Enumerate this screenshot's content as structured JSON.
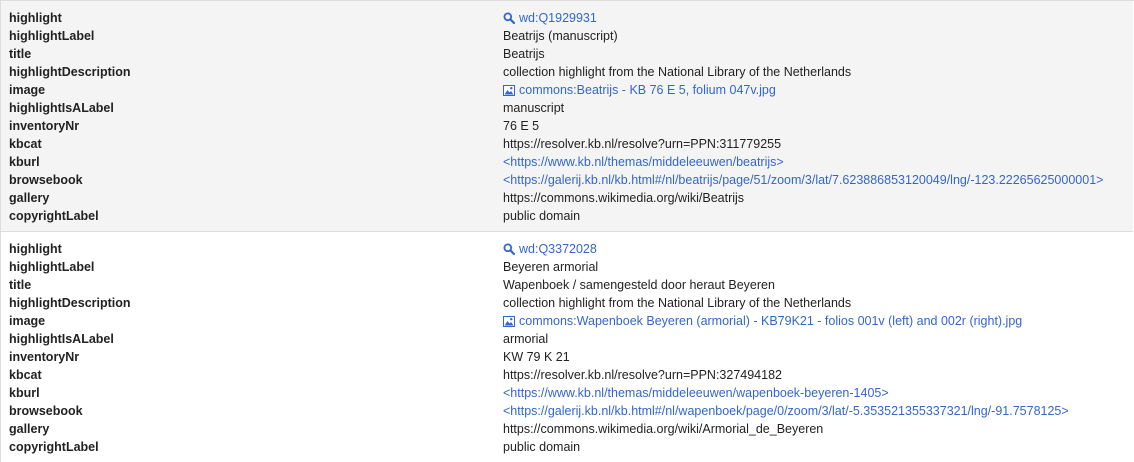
{
  "icons": {
    "entity_link": "search-icon",
    "image_link": "image-icon",
    "link_color": "#3366cc"
  },
  "records": [
    {
      "keys": {
        "highlight": "highlight",
        "highlightLabel": "highlightLabel",
        "title": "title",
        "highlightDescription": "highlightDescription",
        "image": "image",
        "highlightIsALabel": "highlightIsALabel",
        "inventoryNr": "inventoryNr",
        "kbcat": "kbcat",
        "kburl": "kburl",
        "browsebook": "browsebook",
        "gallery": "gallery",
        "copyrightLabel": "copyrightLabel"
      },
      "values": {
        "highlight": "wd:Q1929931",
        "highlightLabel": "Beatrijs (manuscript)",
        "title": "Beatrijs",
        "highlightDescription": "collection highlight from the National Library of the Netherlands",
        "image": "commons:Beatrijs - KB 76 E 5, folium 047v.jpg",
        "highlightIsALabel": "manuscript",
        "inventoryNr": "76 E 5",
        "kbcat": "https://resolver.kb.nl/resolve?urn=PPN:311779255",
        "kburl": "<https://www.kb.nl/themas/middeleeuwen/beatrijs>",
        "browsebook": "<https://galerij.kb.nl/kb.html#/nl/beatrijs/page/51/zoom/3/lat/7.623886853120049/lng/-123.22265625000001>",
        "gallery": "https://commons.wikimedia.org/wiki/Beatrijs",
        "copyrightLabel": "public domain"
      }
    },
    {
      "keys": {
        "highlight": "highlight",
        "highlightLabel": "highlightLabel",
        "title": "title",
        "highlightDescription": "highlightDescription",
        "image": "image",
        "highlightIsALabel": "highlightIsALabel",
        "inventoryNr": "inventoryNr",
        "kbcat": "kbcat",
        "kburl": "kburl",
        "browsebook": "browsebook",
        "gallery": "gallery",
        "copyrightLabel": "copyrightLabel"
      },
      "values": {
        "highlight": "wd:Q3372028",
        "highlightLabel": "Beyeren armorial",
        "title": "Wapenboek / samengesteld door heraut Beyeren",
        "highlightDescription": "collection highlight from the National Library of the Netherlands",
        "image": "commons:Wapenboek Beyeren (armorial) - KB79K21 - folios 001v (left) and 002r (right).jpg",
        "highlightIsALabel": "armorial",
        "inventoryNr": "KW 79 K 21",
        "kbcat": "https://resolver.kb.nl/resolve?urn=PPN:327494182",
        "kburl": "<https://www.kb.nl/themas/middeleeuwen/wapenboek-beyeren-1405>",
        "browsebook": "<https://galerij.kb.nl/kb.html#/nl/wapenboek/page/0/zoom/3/lat/-5.353521355337321/lng/-91.7578125>",
        "gallery": "https://commons.wikimedia.org/wiki/Armorial_de_Beyeren",
        "copyrightLabel": "public domain"
      }
    }
  ]
}
